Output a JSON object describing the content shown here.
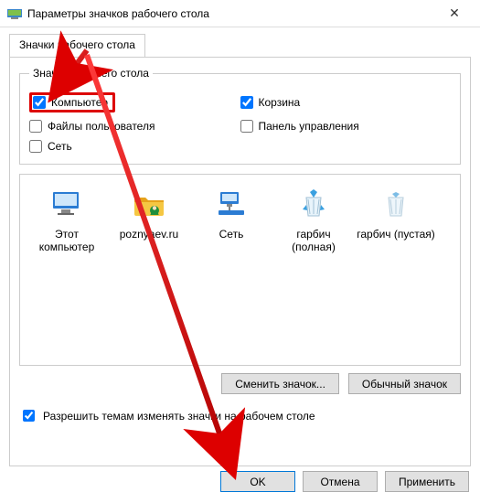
{
  "window": {
    "title": "Параметры значков рабочего стола",
    "close_glyph": "✕"
  },
  "tabs": {
    "main": "Значки рабочего стола"
  },
  "group": {
    "legend": "Значки рабочего стола",
    "items": {
      "computer": "Компьютер",
      "recyclebin": "Корзина",
      "userfiles": "Файлы пользователя",
      "controlpanel": "Панель управления",
      "network": "Сеть"
    },
    "checked": {
      "computer": true,
      "recyclebin": true,
      "userfiles": false,
      "controlpanel": false,
      "network": false
    }
  },
  "preview": {
    "items": [
      {
        "name": "this-pc",
        "label": "Этот компьютер"
      },
      {
        "name": "user-folder",
        "label": "poznyaev.ru"
      },
      {
        "name": "network",
        "label": "Сеть"
      },
      {
        "name": "recycle-full",
        "label": "гарбич (полная)"
      },
      {
        "name": "recycle-empty",
        "label": "гарбич (пустая)"
      }
    ]
  },
  "buttons": {
    "change_icon": "Сменить значок...",
    "default_icon": "Обычный значок",
    "ok": "OK",
    "cancel": "Отмена",
    "apply": "Применить"
  },
  "themes_checkbox": {
    "label": "Разрешить темам изменять значки на рабочем столе",
    "checked": true
  }
}
